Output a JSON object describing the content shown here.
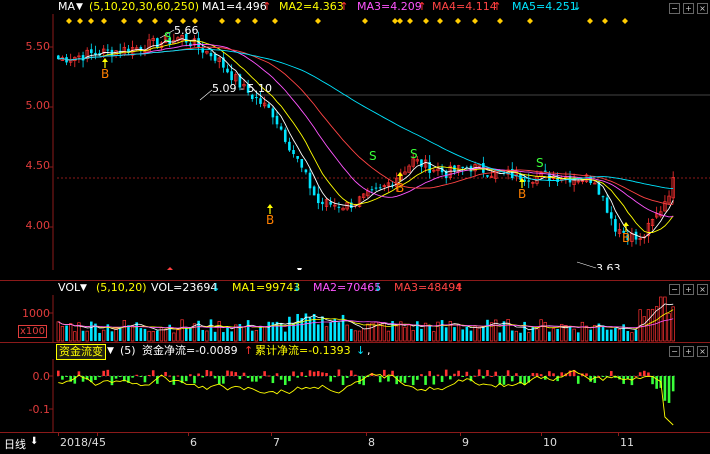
{
  "main_panel": {
    "indicator": "MA",
    "params": "(5,10,20,30,60,250)",
    "ma_values": [
      {
        "label": "MA1=4.496",
        "arrow": "↑",
        "color": "#ffffff"
      },
      {
        "label": "MA2=4.363",
        "arrow": "↑",
        "color": "#ffff00"
      },
      {
        "label": "MA3=4.209",
        "arrow": "↑",
        "color": "#ff55ff"
      },
      {
        "label": "MA4=4.114",
        "arrow": "↑",
        "color": "#ff4444"
      },
      {
        "label": "MA5=4.251",
        "arrow": "↓",
        "color": "#00e5ff"
      }
    ],
    "y_ticks": [
      "5.50",
      "5.00",
      "4.50",
      "4.00"
    ],
    "annotations": {
      "high": "5.66",
      "range": "5.09 - 5.10",
      "low": "3.63"
    },
    "buy_marker": "B",
    "sell_marker": "S"
  },
  "volume_panel": {
    "indicator": "VOL",
    "params": "(5,10,20)",
    "values": [
      {
        "label": "VOL=23694",
        "arrow": "↓",
        "color": "#ffffff"
      },
      {
        "label": "MA1=99743",
        "arrow": "↓",
        "color": "#ffff00"
      },
      {
        "label": "MA2=70465",
        "arrow": "↓",
        "color": "#ff55ff"
      },
      {
        "label": "MA3=48494",
        "arrow": "↑",
        "color": "#ff4444"
      }
    ],
    "y_tick": "1000",
    "unit": "x100"
  },
  "flow_panel": {
    "tab_label": "资金流变",
    "params": "(5)",
    "net_flow": "资金净流=-0.0089",
    "net_flow_arrow": "↑",
    "cum_flow": "累计净流=-0.1393",
    "cum_flow_arrow": "↓",
    "trailing": ",",
    "y_ticks": [
      "0.0",
      "-0.1"
    ]
  },
  "time_axis": {
    "period_button": "日线",
    "period_arrow": "⬇",
    "labels": [
      "2018/4",
      "5",
      "6",
      "7",
      "8",
      "9",
      "10",
      "11"
    ]
  },
  "colors": {
    "up": "#ff3232",
    "down": "#00e5ff",
    "frame": "#8b1a1a"
  }
}
